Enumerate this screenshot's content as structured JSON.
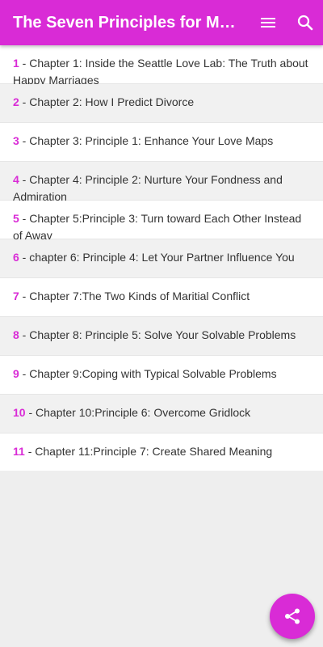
{
  "app_bar": {
    "title": "The Seven Principles for Mak...",
    "menu_icon": "menu-icon",
    "search_icon": "search-icon",
    "color": "#d92bd6"
  },
  "chapters": [
    {
      "number": "1",
      "title": "Chapter 1: Inside the Seattle Love Lab: The Truth about Happy Marriages"
    },
    {
      "number": "2",
      "title": "Chapter 2: How I Predict Divorce"
    },
    {
      "number": "3",
      "title": "Chapter 3: Principle 1: Enhance Your Love Maps"
    },
    {
      "number": "4",
      "title": "Chapter 4: Principle 2: Nurture Your Fondness and Admiration"
    },
    {
      "number": "5",
      "title": "Chapter 5:Principle 3: Turn toward Each Other Instead of Away"
    },
    {
      "number": "6",
      "title": "chapter 6: Principle 4: Let Your Partner Influence You"
    },
    {
      "number": "7",
      "title": "Chapter 7:The Two Kinds of Maritial Conflict"
    },
    {
      "number": "8",
      "title": "Chapter 8: Principle 5: Solve Your Solvable Problems"
    },
    {
      "number": "9",
      "title": "Chapter 9:Coping with Typical Solvable Problems"
    },
    {
      "number": "10",
      "title": "Chapter 10:Principle 6: Overcome Gridlock"
    },
    {
      "number": "11",
      "title": "Chapter 11:Principle 7: Create Shared Meaning"
    }
  ],
  "fab": {
    "icon": "share-icon"
  }
}
